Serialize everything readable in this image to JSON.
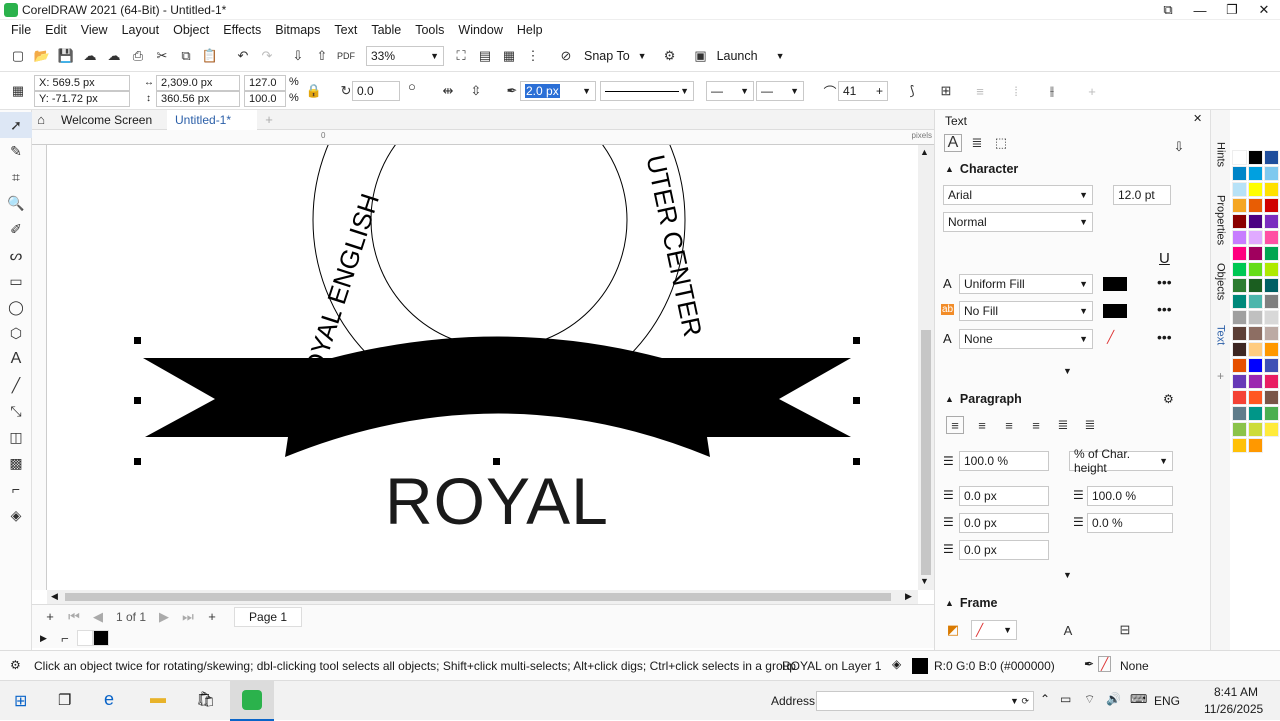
{
  "app": {
    "title": "CorelDRAW 2021 (64-Bit) - Untitled-1*"
  },
  "menu": [
    "File",
    "Edit",
    "View",
    "Layout",
    "Object",
    "Effects",
    "Bitmaps",
    "Text",
    "Table",
    "Tools",
    "Window",
    "Help"
  ],
  "toolbar": {
    "zoom": "33%",
    "snap_label": "Snap To",
    "launch_label": "Launch"
  },
  "propbar": {
    "x": "X: 569.5 px",
    "y": "Y: -71.72 px",
    "w": "2,309.0 px",
    "h": "360.56 px",
    "sx": "127.0",
    "sy": "100.0",
    "pct1": "%",
    "pct2": "%",
    "angle": "0.0",
    "outline_width": "2.0 px",
    "miter": "41"
  },
  "tabs": {
    "welcome": "Welcome Screen",
    "doc": "Untitled-1*"
  },
  "ruler": {
    "units": "pixels",
    "ticks": [
      "0"
    ]
  },
  "canvas": {
    "arc_text_left": "OYAL ENGLISH",
    "arc_text_right": "UTER CENTER",
    "main_text": "ROYAL"
  },
  "pagebar": {
    "pages": "1 of 1",
    "page_tab": "Page 1"
  },
  "docker": {
    "title": "Text",
    "character": "Character",
    "font": "Arial",
    "size": "12.0 pt",
    "style": "Normal",
    "fill1": "Uniform Fill",
    "fill2": "No Fill",
    "outline": "None",
    "paragraph": "Paragraph",
    "line_spacing": "100.0 %",
    "line_spacing_unit": "% of Char. height",
    "before": "0.0 px",
    "char_spacing": "100.0 %",
    "after": "0.0 px",
    "word_spacing": "0.0 %",
    "indent": "0.0 px",
    "frame": "Frame"
  },
  "sidetabs": [
    "Hints",
    "Properties",
    "Objects",
    "Text"
  ],
  "palette": {
    "colors": [
      "#ffffff",
      "#000000",
      "#1f4e9c",
      "#0085c8",
      "#00a0e0",
      "#7fc9ef",
      "#b7e2f7",
      "#ffff00",
      "#ffe100",
      "#f5a623",
      "#e85d04",
      "#d00000",
      "#8b0000",
      "#4b0082",
      "#7b2cbf",
      "#c77dff",
      "#e0aaff",
      "#ff4fa3",
      "#ff007f",
      "#a0005e",
      "#00a651",
      "#00c853",
      "#64dd17",
      "#aeea00",
      "#2e7d32",
      "#1b5e20",
      "#006064",
      "#00897b",
      "#4db6ac",
      "#808080",
      "#a0a0a0",
      "#c0c0c0",
      "#d8d8d8",
      "#5d4037",
      "#8d6e63",
      "#bcaaa4",
      "#3e2723",
      "#ffcc80",
      "#ff9800",
      "#e65100",
      "#0000ff",
      "#3f51b5",
      "#673ab7",
      "#9c27b0",
      "#e91e63",
      "#f44336",
      "#ff5722",
      "#795548",
      "#607d8b",
      "#009688",
      "#4caf50",
      "#8bc34a",
      "#cddc39",
      "#ffeb3b",
      "#ffc107",
      "#ff9800"
    ]
  },
  "status": {
    "hint": "Click an object twice for rotating/skewing; dbl-clicking tool selects all objects; Shift+click multi-selects; Alt+click digs; Ctrl+click selects in a group",
    "layer": "ROYAL on Layer 1",
    "fill": "R:0 G:0 B:0 (#000000)",
    "outline": "None"
  },
  "taskbar": {
    "address": "Address",
    "lang": "ENG",
    "time": "8:41 AM",
    "date": "11/26/2025"
  }
}
